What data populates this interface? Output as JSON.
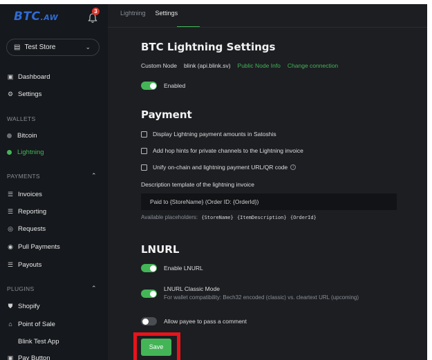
{
  "sidebar": {
    "logo": "BTC",
    "logo_suffix": ".AW",
    "notification_count": "3",
    "store": "Test Store",
    "nav_top": [
      {
        "label": "Dashboard",
        "icon": "dashboard-icon"
      },
      {
        "label": "Settings",
        "icon": "gear-icon"
      }
    ],
    "wallets_header": "WALLETS",
    "wallets": [
      {
        "label": "Bitcoin",
        "status": "inactive"
      },
      {
        "label": "Lightning",
        "status": "active"
      }
    ],
    "payments_header": "PAYMENTS",
    "payments": [
      {
        "label": "Invoices",
        "icon": "invoice-icon"
      },
      {
        "label": "Reporting",
        "icon": "reporting-icon"
      },
      {
        "label": "Requests",
        "icon": "requests-icon"
      },
      {
        "label": "Pull Payments",
        "icon": "pull-payments-icon"
      },
      {
        "label": "Payouts",
        "icon": "payouts-icon"
      }
    ],
    "plugins_header": "PLUGINS",
    "plugins": [
      {
        "label": "Shopify",
        "icon": "shopify-icon"
      },
      {
        "label": "Point of Sale",
        "icon": "pos-icon"
      },
      {
        "label": "Blink Test App",
        "icon": ""
      },
      {
        "label": "Pay Button",
        "icon": "pay-button-icon"
      }
    ]
  },
  "tabs": [
    "Lightning",
    "Settings"
  ],
  "settings": {
    "title": "BTC Lightning Settings",
    "custom_node_label": "Custom Node",
    "custom_node_value": "blink (api.blink.sv)",
    "public_node_info": "Public Node Info",
    "change_connection": "Change connection",
    "enabled_label": "Enabled"
  },
  "payment": {
    "title": "Payment",
    "options": [
      "Display Lightning payment amounts in Satoshis",
      "Add hop hints for private channels to the Lightning invoice",
      "Unify on-chain and lightning payment URL/QR code"
    ],
    "description_label": "Description template of the lightning invoice",
    "description_value": "Paid to {StoreName} (Order ID: {OrderId})",
    "placeholders_label": "Available placeholders:",
    "placeholders": [
      "{StoreName}",
      "{ItemDescription}",
      "{OrderId}"
    ]
  },
  "lnurl": {
    "title": "LNURL",
    "enable_label": "Enable LNURL",
    "classic_label": "LNURL Classic Mode",
    "classic_sub": "For wallet compatibility: Bech32 encoded (classic) vs. cleartext URL (upcoming)",
    "comment_label": "Allow payee to pass a comment"
  },
  "save_label": "Save",
  "colors": {
    "accent": "#44b557",
    "highlight": "#e8131b"
  }
}
